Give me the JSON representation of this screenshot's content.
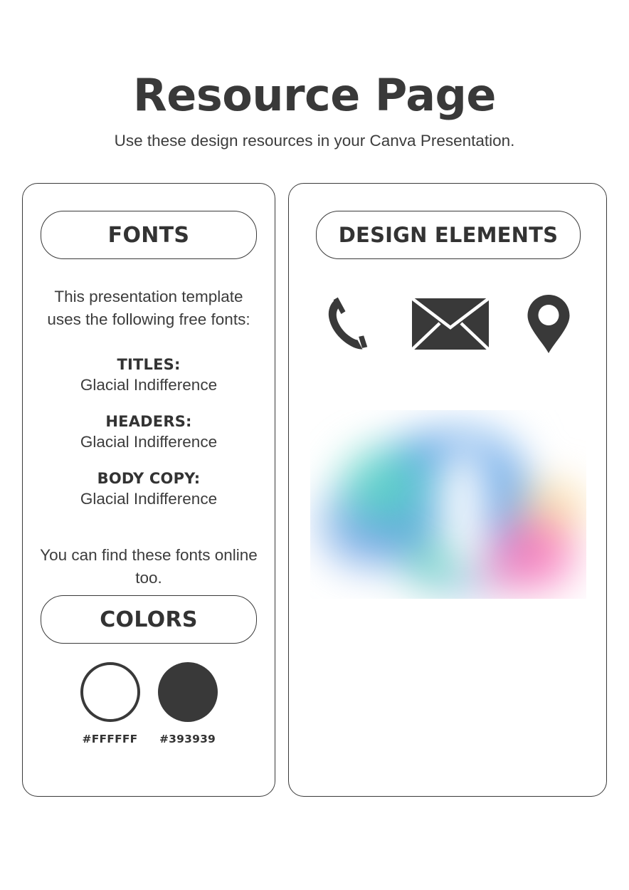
{
  "header": {
    "title": "Resource Page",
    "subtitle": "Use these design resources in your Canva Presentation."
  },
  "fonts_panel": {
    "heading": "FONTS",
    "intro": "This presentation template uses the following free fonts:",
    "groups": [
      {
        "label": "TITLES:",
        "value": "Glacial Indifference"
      },
      {
        "label": "HEADERS:",
        "value": "Glacial Indifference"
      },
      {
        "label": "BODY COPY:",
        "value": "Glacial Indifference"
      }
    ],
    "outro": "You can find these fonts online too."
  },
  "colors_panel": {
    "heading": "COLORS",
    "swatches": [
      {
        "name": "white-swatch",
        "hex": "#FFFFFF",
        "style": "outline"
      },
      {
        "name": "dark-swatch",
        "hex": "#393939",
        "style": "filled"
      }
    ]
  },
  "design_panel": {
    "heading": "DESIGN ELEMENTS",
    "icons": [
      {
        "name": "phone-icon",
        "label": "phone"
      },
      {
        "name": "envelope-icon",
        "label": "envelope"
      },
      {
        "name": "location-pin-icon",
        "label": "location pin"
      }
    ],
    "graphic": {
      "name": "gradient-blob-graphic",
      "colors": [
        "#5b9ee0",
        "#63d8c4",
        "#f06ab0",
        "#f7d59a",
        "#ffffff"
      ]
    }
  },
  "theme": {
    "ink": "#393939",
    "background": "#FFFFFF",
    "border": "#3A3A3A"
  }
}
